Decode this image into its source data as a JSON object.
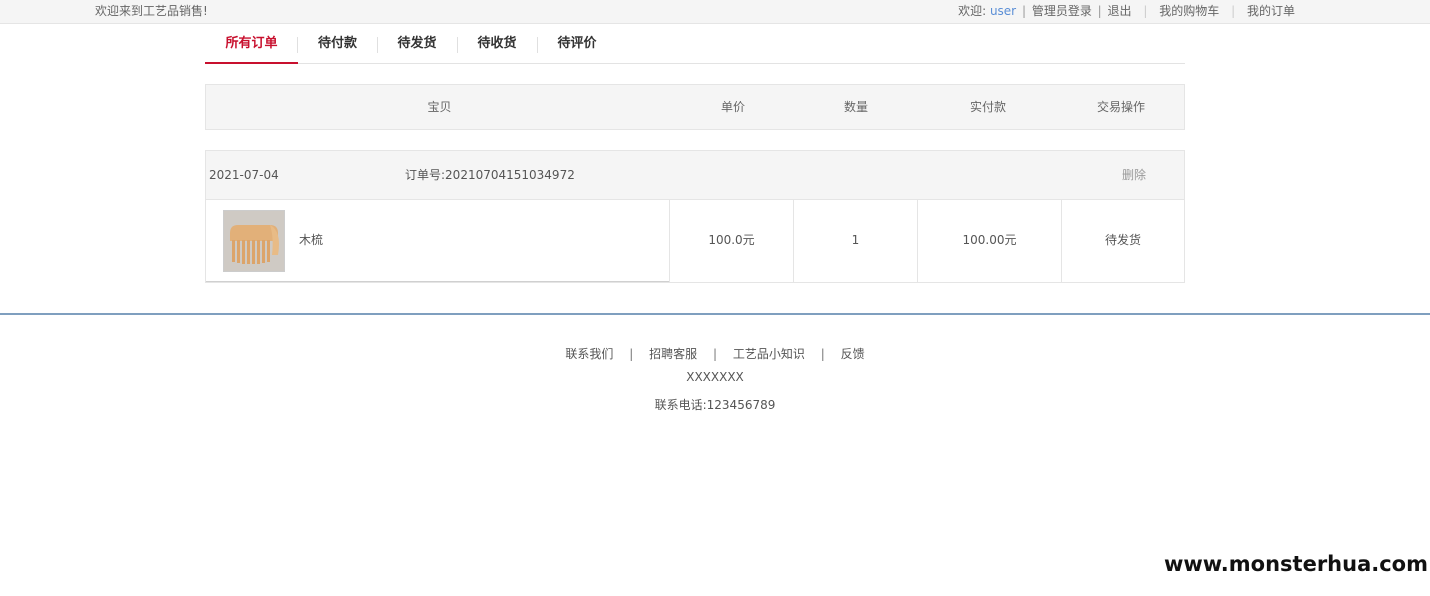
{
  "topbar": {
    "welcome": "欢迎来到工艺品销售!",
    "greeting": "欢迎:",
    "username": "user",
    "admin_login": "管理员登录",
    "logout": "退出",
    "cart": "我的购物车",
    "orders": "我的订单"
  },
  "tabs": [
    {
      "label": "所有订单",
      "active": true
    },
    {
      "label": "待付款",
      "active": false
    },
    {
      "label": "待发货",
      "active": false
    },
    {
      "label": "待收货",
      "active": false
    },
    {
      "label": "待评价",
      "active": false
    }
  ],
  "table_header": {
    "item": "宝贝",
    "unit_price": "单价",
    "quantity": "数量",
    "paid": "实付款",
    "action": "交易操作"
  },
  "orders": [
    {
      "date": "2021-07-04",
      "order_no": "订单号:20210704151034972",
      "delete_label": "删除",
      "product_name": "木梳",
      "unit_price": "100.0元",
      "quantity": "1",
      "paid": "100.00元",
      "status": "待发货"
    }
  ],
  "footer": {
    "links": [
      "联系我们",
      "招聘客服",
      "工艺品小知识",
      "反馈"
    ],
    "line2": "XXXXXXX",
    "phone": "联系电话:123456789"
  },
  "watermark": "www.monsterhua.com",
  "colors": {
    "accent": "#c8102e",
    "user_link": "#5a8ed6",
    "footer_line": "#7f9fbf"
  }
}
